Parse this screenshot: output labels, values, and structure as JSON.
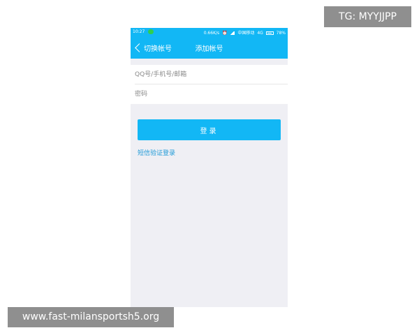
{
  "status_bar": {
    "time": "10:27",
    "network_speed": "0.66K/s",
    "carrier": "中国移动",
    "network_type": "4G",
    "battery": "78%",
    "icons": [
      "wechat-icon",
      "alarm-icon",
      "signal-icon",
      "battery-icon"
    ]
  },
  "nav": {
    "back_label": "切换帐号",
    "title": "添加帐号"
  },
  "form": {
    "account_placeholder": "QQ号/手机号/邮箱",
    "account_value": "",
    "password_placeholder": "密码",
    "password_value": ""
  },
  "actions": {
    "login_label": "登录",
    "sms_login_label": "短信验证登录"
  },
  "overlays": {
    "tg_text": "TG: MYYJJPP",
    "url_text": "www.fast-milansportsh5.org"
  },
  "colors": {
    "accent": "#12b7f5",
    "background": "#efeff4",
    "link": "#1f9ad7"
  }
}
